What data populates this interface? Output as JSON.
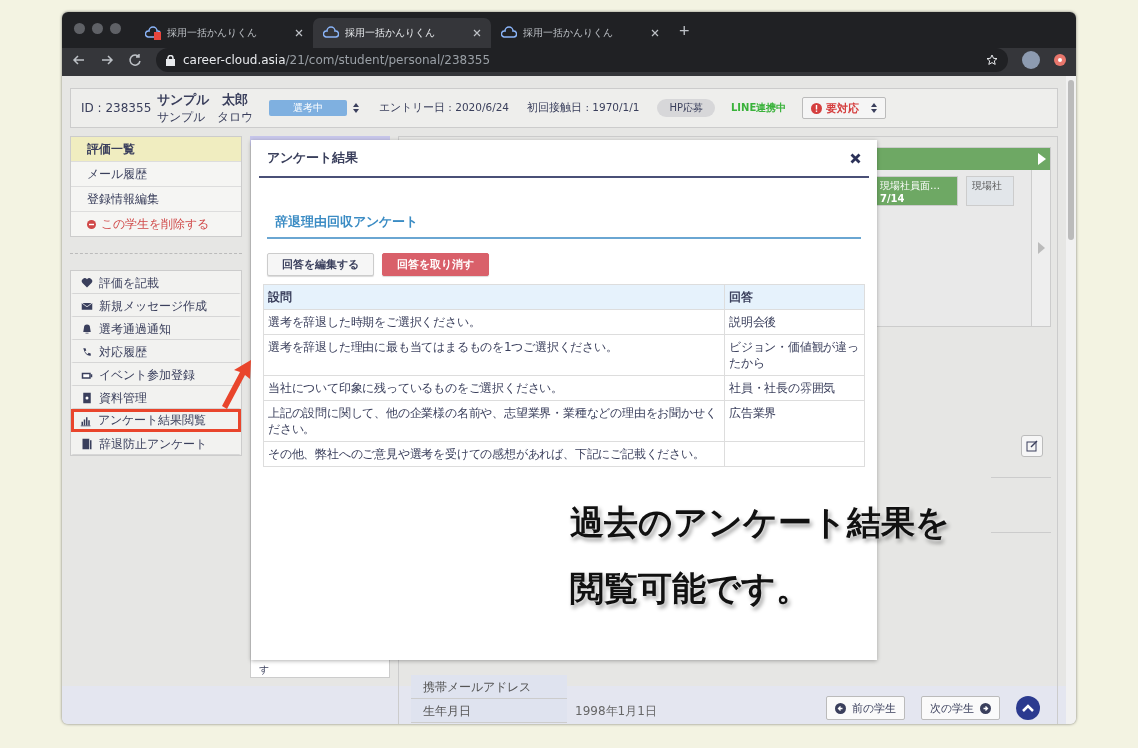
{
  "browser": {
    "tabs": [
      {
        "title": "採用一括かんりくん",
        "selected": false,
        "alert": true
      },
      {
        "title": "採用一括かんりくん",
        "selected": true,
        "alert": false
      },
      {
        "title": "採用一括かんりくん",
        "selected": false,
        "alert": false
      }
    ],
    "new_tab": "+",
    "url_host": "career-cloud.asia",
    "url_path": "/21/com/student/personal/238355"
  },
  "header": {
    "id": "ID : 238355",
    "name": "サンプル　太郎",
    "kana": "サンプル　タロウ",
    "status": "選考中",
    "entry_date": "エントリー日 : 2020/6/24",
    "first_contact": "初回接触日 : 1970/1/1",
    "channel": "HP応募",
    "line": "LINE連携中",
    "action": "要対応"
  },
  "sidebar": {
    "menu": [
      {
        "label": "評価一覧",
        "selected": true,
        "kind": "link"
      },
      {
        "label": "メール履歴",
        "selected": false,
        "kind": "link"
      },
      {
        "label": "登録情報編集",
        "selected": false,
        "kind": "link"
      },
      {
        "label": "この学生を削除する",
        "selected": false,
        "kind": "danger"
      }
    ],
    "actions": [
      {
        "label": "評価を記載",
        "highlighted": false
      },
      {
        "label": "新規メッセージ作成",
        "highlighted": false
      },
      {
        "label": "選考通過通知",
        "highlighted": false
      },
      {
        "label": "対応履歴",
        "highlighted": false
      },
      {
        "label": "イベント参加登録",
        "highlighted": false
      },
      {
        "label": "資料管理",
        "highlighted": false
      },
      {
        "label": "アンケート結果閲覧",
        "highlighted": true
      },
      {
        "label": "辞退防止アンケート",
        "highlighted": false
      }
    ]
  },
  "middle_panel": {
    "text": "す"
  },
  "timeline": {
    "cards": [
      {
        "title": "現場社員面…",
        "date": "7/14",
        "done": true
      },
      {
        "title": "現場社",
        "done": false
      }
    ]
  },
  "profile": {
    "rows": [
      {
        "label": "携帯メールアドレス"
      },
      {
        "label": "生年月日",
        "value": "1998年1月1日"
      }
    ]
  },
  "footer": {
    "prev": "前の学生",
    "next": "次の学生"
  },
  "modal": {
    "title": "アンケート結果",
    "survey_title": "辞退理由回収アンケート",
    "buttons": [
      {
        "label": "回答を編集する",
        "kind": "default"
      },
      {
        "label": "回答を取り消す",
        "kind": "danger"
      }
    ],
    "columns": [
      "設問",
      "回答"
    ],
    "rows": [
      [
        "選考を辞退した時期をご選択ください。",
        "説明会後"
      ],
      [
        "選考を辞退した理由に最も当てはまるものを1つご選択ください。",
        "ビジョン・価値観が違ったから"
      ],
      [
        "当社について印象に残っているものをご選択ください。",
        "社員・社長の雰囲気"
      ],
      [
        "上記の設問に関して、他の企業様の名前や、志望業界・業種などの理由をお聞かせください。",
        "広告業界"
      ],
      [
        "その他、弊社へのご意見や選考を受けての感想があれば、下記にご記載ください。",
        ""
      ]
    ]
  },
  "caption": {
    "lines": [
      "過去のアンケート結果を",
      "閲覧可能です。"
    ]
  }
}
